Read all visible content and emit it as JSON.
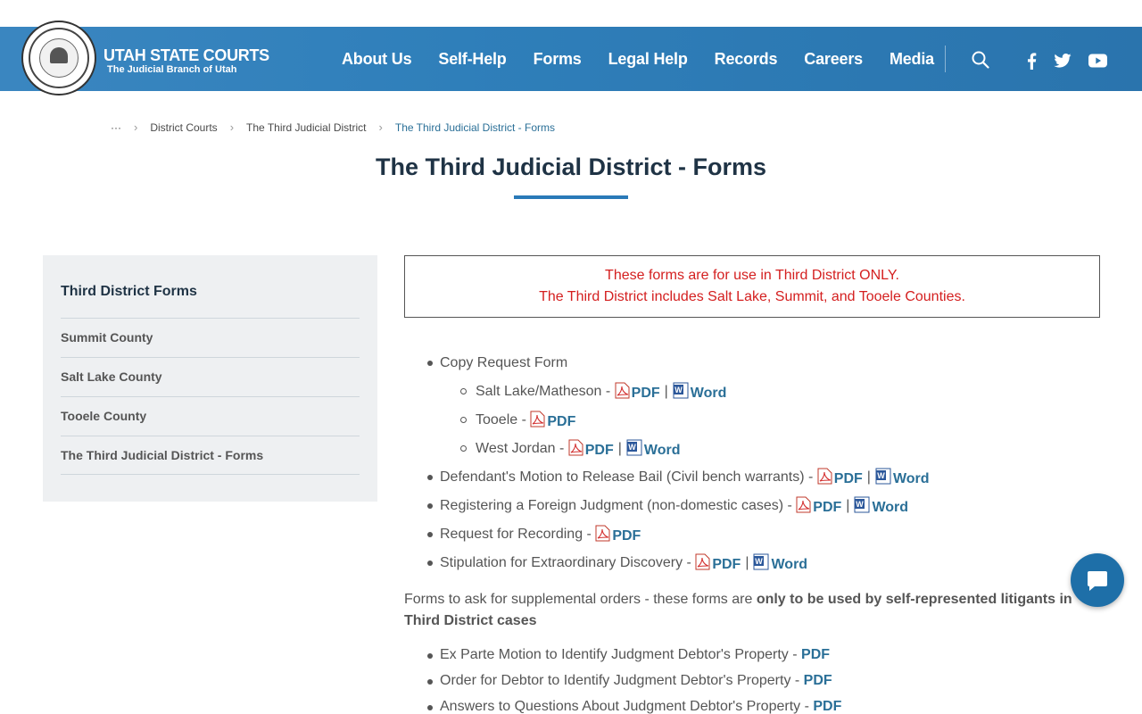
{
  "header": {
    "logo_title": "UTAH STATE COURTS",
    "logo_subtitle": "The Judicial Branch of Utah",
    "nav": [
      "About Us",
      "Self-Help",
      "Forms",
      "Legal Help",
      "Records",
      "Careers",
      "Media"
    ],
    "icons": [
      "search-icon",
      "facebook-icon",
      "twitter-icon",
      "youtube-icon"
    ]
  },
  "breadcrumb": {
    "ellipsis": "···",
    "items": [
      "District Courts",
      "The Third Judicial District"
    ],
    "current": "The Third Judicial District - Forms"
  },
  "page_title": "The Third Judicial District - Forms",
  "sidebar": {
    "heading": "Third District Forms",
    "items": [
      "Summit County",
      "Salt Lake County",
      "Tooele County",
      "The Third Judicial District - Forms"
    ]
  },
  "notice": {
    "line1": "These forms are for use in Third District ONLY.",
    "line2": "The Third District includes Salt Lake, Summit, and Tooele Counties."
  },
  "forms": {
    "copy_request": "Copy Request Form",
    "salt_lake": "Salt Lake/Matheson - ",
    "tooele": "Tooele - ",
    "west_jordan": "West Jordan - ",
    "defendant_motion": "Defendant's Motion to Release Bail (Civil bench warrants) - ",
    "foreign_judgment": "Registering a Foreign Judgment (non-domestic cases) - ",
    "recording": "Request for Recording - ",
    "stipulation": "Stipulation for Extraordinary Discovery - ",
    "pdf": "PDF",
    "word": "Word",
    "bar": "|"
  },
  "supplemental": {
    "intro": "Forms to ask for supplemental orders - these forms are ",
    "bold": "only to be used by self-represented litigants in Third District cases",
    "items": [
      "Ex Parte Motion to Identify Judgment Debtor's Property - ",
      "Order for Debtor to Identify Judgment Debtor's Property - ",
      "Answers to Questions About Judgment Debtor's Property - "
    ]
  },
  "colors": {
    "header": "#2f7fba",
    "link": "#2a6f97",
    "notice": "#d41f1f",
    "title": "#1f3345"
  }
}
